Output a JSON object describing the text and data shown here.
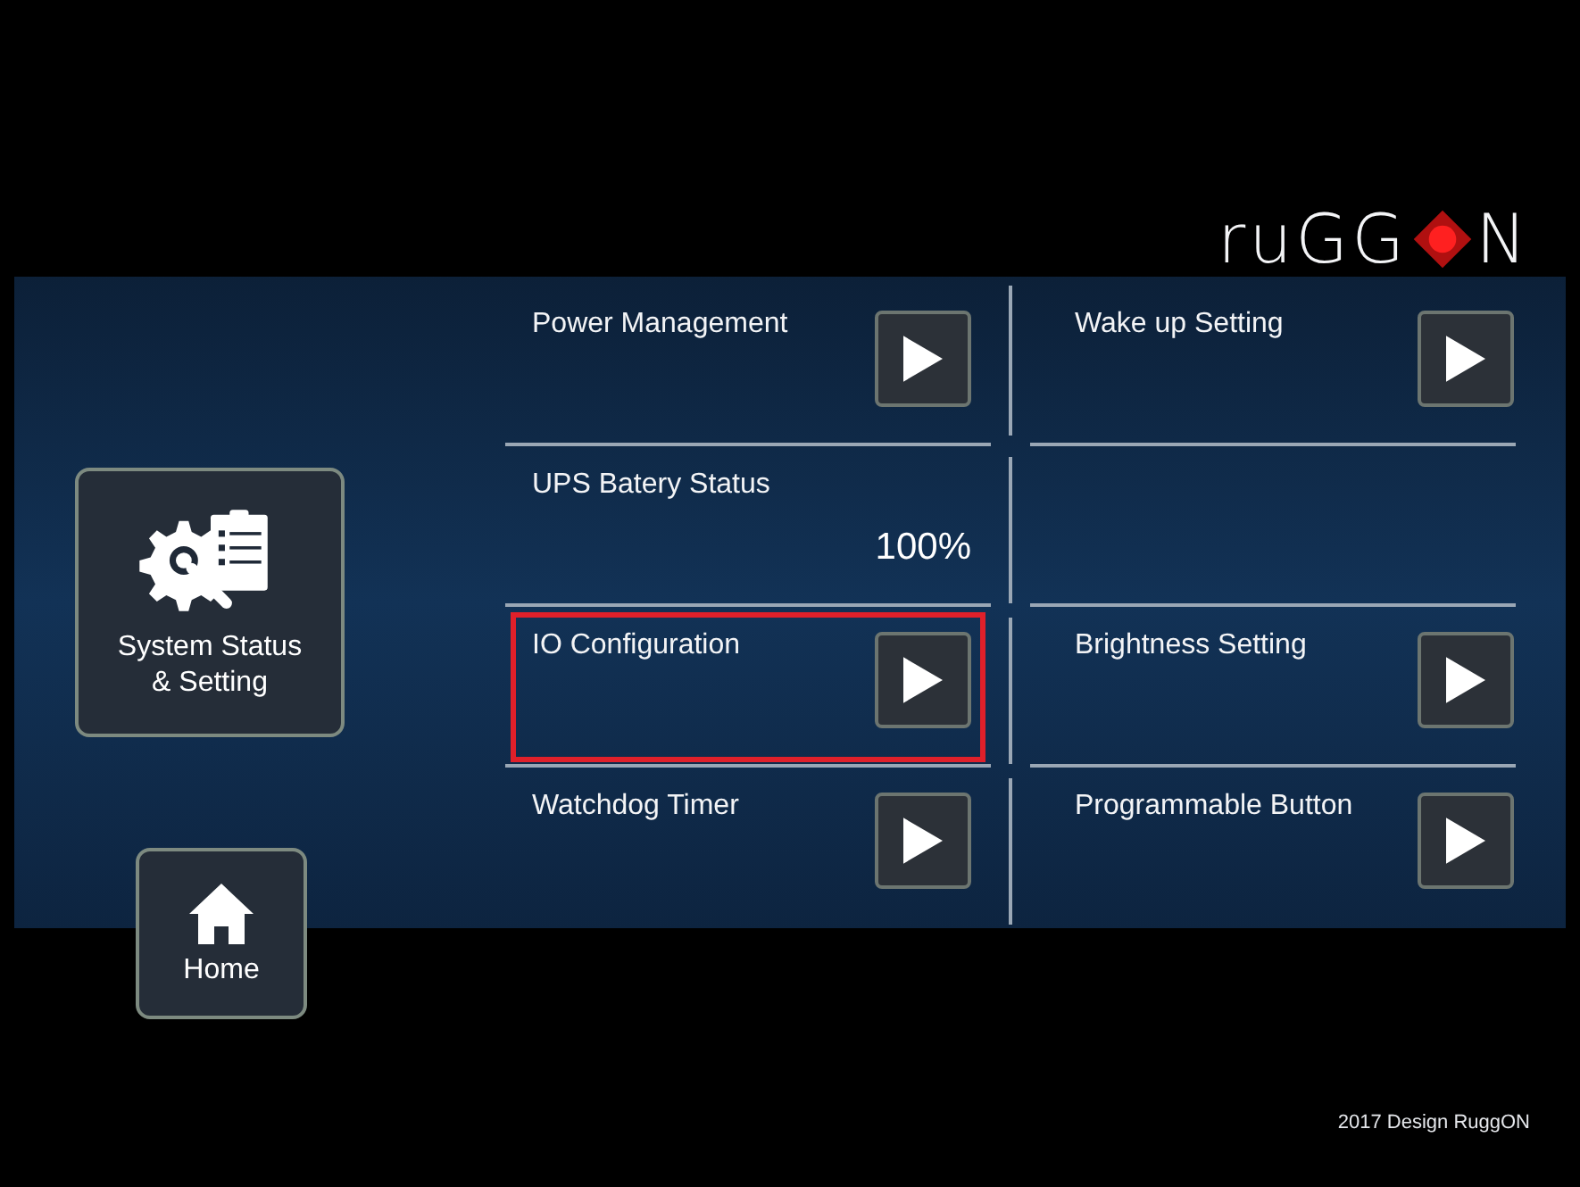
{
  "logo": {
    "left": "ruGG",
    "right": "N"
  },
  "side_buttons": [
    {
      "kind": "settings",
      "label": "System Status\n& Setting"
    },
    {
      "kind": "home",
      "label": "Home"
    }
  ],
  "grid": [
    {
      "kind": "nav",
      "label": "Power Management",
      "highlighted": false
    },
    {
      "kind": "nav",
      "label": "Wake up Setting",
      "highlighted": false
    },
    {
      "kind": "status",
      "label": "UPS Batery Status",
      "value": "100%",
      "highlighted": false
    },
    {
      "kind": "empty",
      "highlighted": false
    },
    {
      "kind": "nav",
      "label": "IO Configuration",
      "highlighted": true
    },
    {
      "kind": "nav",
      "label": "Brightness Setting",
      "highlighted": false
    },
    {
      "kind": "nav",
      "label": "Watchdog Timer",
      "highlighted": false
    },
    {
      "kind": "nav",
      "label": "Programmable Button",
      "highlighted": false
    }
  ],
  "footer": "2017 Design RuggON"
}
